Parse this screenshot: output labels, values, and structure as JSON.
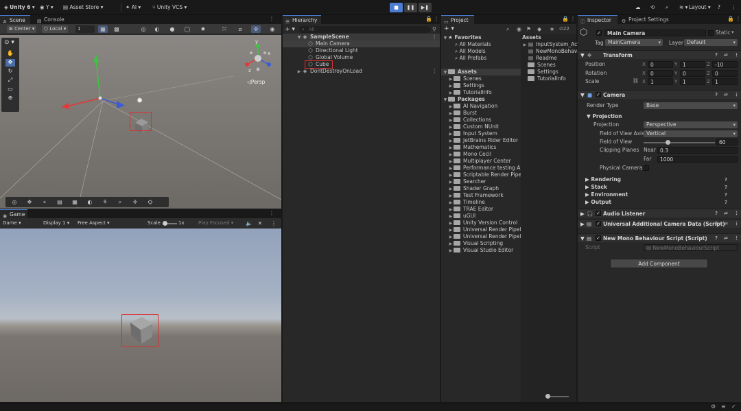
{
  "topbar": {
    "app": "Unity 6",
    "account": "Y",
    "asset_store": "Asset Store",
    "ai": "AI",
    "vcs": "Unity VCS",
    "layout": "Layout",
    "play": "■",
    "pause": "❚❚",
    "step": "▶❚"
  },
  "scene": {
    "tab_scene": "Scene",
    "tab_console": "Console",
    "pivot_center": "Center",
    "pivot_local": "Local",
    "grid_size": "1",
    "persp": "◁Persp",
    "gizmo_x": "x",
    "gizmo_y": "y",
    "gizmo_z": "z"
  },
  "game": {
    "tab": "Game",
    "mode": "Game",
    "display": "Display 1",
    "aspect": "Free Aspect",
    "scale_label": "Scale",
    "scale_value": "1x",
    "play_focused": "Play Focused"
  },
  "hierarchy": {
    "tab": "Hierarchy",
    "search_placeholder": "All",
    "items": [
      {
        "label": "SampleScene"
      },
      {
        "label": "Main Camera"
      },
      {
        "label": "Directional Light"
      },
      {
        "label": "Global Volume"
      },
      {
        "label": "Cube"
      },
      {
        "label": "DontDestroyOnLoad"
      }
    ]
  },
  "project": {
    "tab": "Project",
    "count": "22",
    "favorites": "Favorites",
    "fav_items": [
      "All Materials",
      "All Models",
      "All Prefabs"
    ],
    "assets": "Assets",
    "asset_items": [
      "Scenes",
      "Settings",
      "TutorialInfo"
    ],
    "packages": "Packages",
    "package_items": [
      "AI Navigation",
      "Burst",
      "Collections",
      "Custom NUnit",
      "Input System",
      "JetBrains Rider Editor",
      "Mathematics",
      "Mono Cecil",
      "Multiplayer Center",
      "Performance testing AP",
      "Scriptable Render Pipeli",
      "Searcher",
      "Shader Graph",
      "Test Framework",
      "Timeline",
      "TRAE Editor",
      "uGUI",
      "Unity Version Control",
      "Universal Render Pipelin",
      "Universal Render Pipelin",
      "Visual Scripting",
      "Visual Studio Editor"
    ],
    "right_header": "Assets",
    "right_items": [
      "InputSystem_Act",
      "NewMonoBehavi",
      "Readme",
      "Scenes",
      "Settings",
      "TutorialInfo"
    ]
  },
  "inspector": {
    "tab": "Inspector",
    "tab2": "Project Settings",
    "name": "Main Camera",
    "static": "Static",
    "tag_label": "Tag",
    "tag": "MainCamera",
    "layer_label": "Layer",
    "layer": "Default",
    "transform": "Transform",
    "position": "Position",
    "rotation": "Rotation",
    "scale": "Scale",
    "pos": [
      "0",
      "1",
      "-10"
    ],
    "rot": [
      "0",
      "0",
      "0"
    ],
    "scl": [
      "1",
      "1",
      "1"
    ],
    "x": "X",
    "y": "Y",
    "z": "Z",
    "camera": "Camera",
    "render_type_label": "Render Type",
    "render_type": "Base",
    "projection_head": "Projection",
    "projection_label": "Projection",
    "projection": "Perspective",
    "fov_axis_label": "Field of View Axis",
    "fov_axis": "Vertical",
    "fov_label": "Field of View",
    "fov": "60",
    "clip_label": "Clipping Planes",
    "near_label": "Near",
    "near": "0.3",
    "far_label": "Far",
    "far": "1000",
    "physical": "Physical Camera",
    "rendering": "Rendering",
    "stack": "Stack",
    "environment": "Environment",
    "output": "Output",
    "audio_listener": "Audio Listener",
    "urp_data": "Universal Additional Camera Data (Script)",
    "mono": "New Mono Behaviour Script (Script)",
    "script_label": "Script",
    "script_value": "NewMonoBehaviourScript",
    "add_component": "Add Component"
  },
  "colors": {
    "accent": "#4c7dd3",
    "highlight": "#d93030",
    "sky": "#a9b4c6",
    "ground": "#6f6b66"
  }
}
